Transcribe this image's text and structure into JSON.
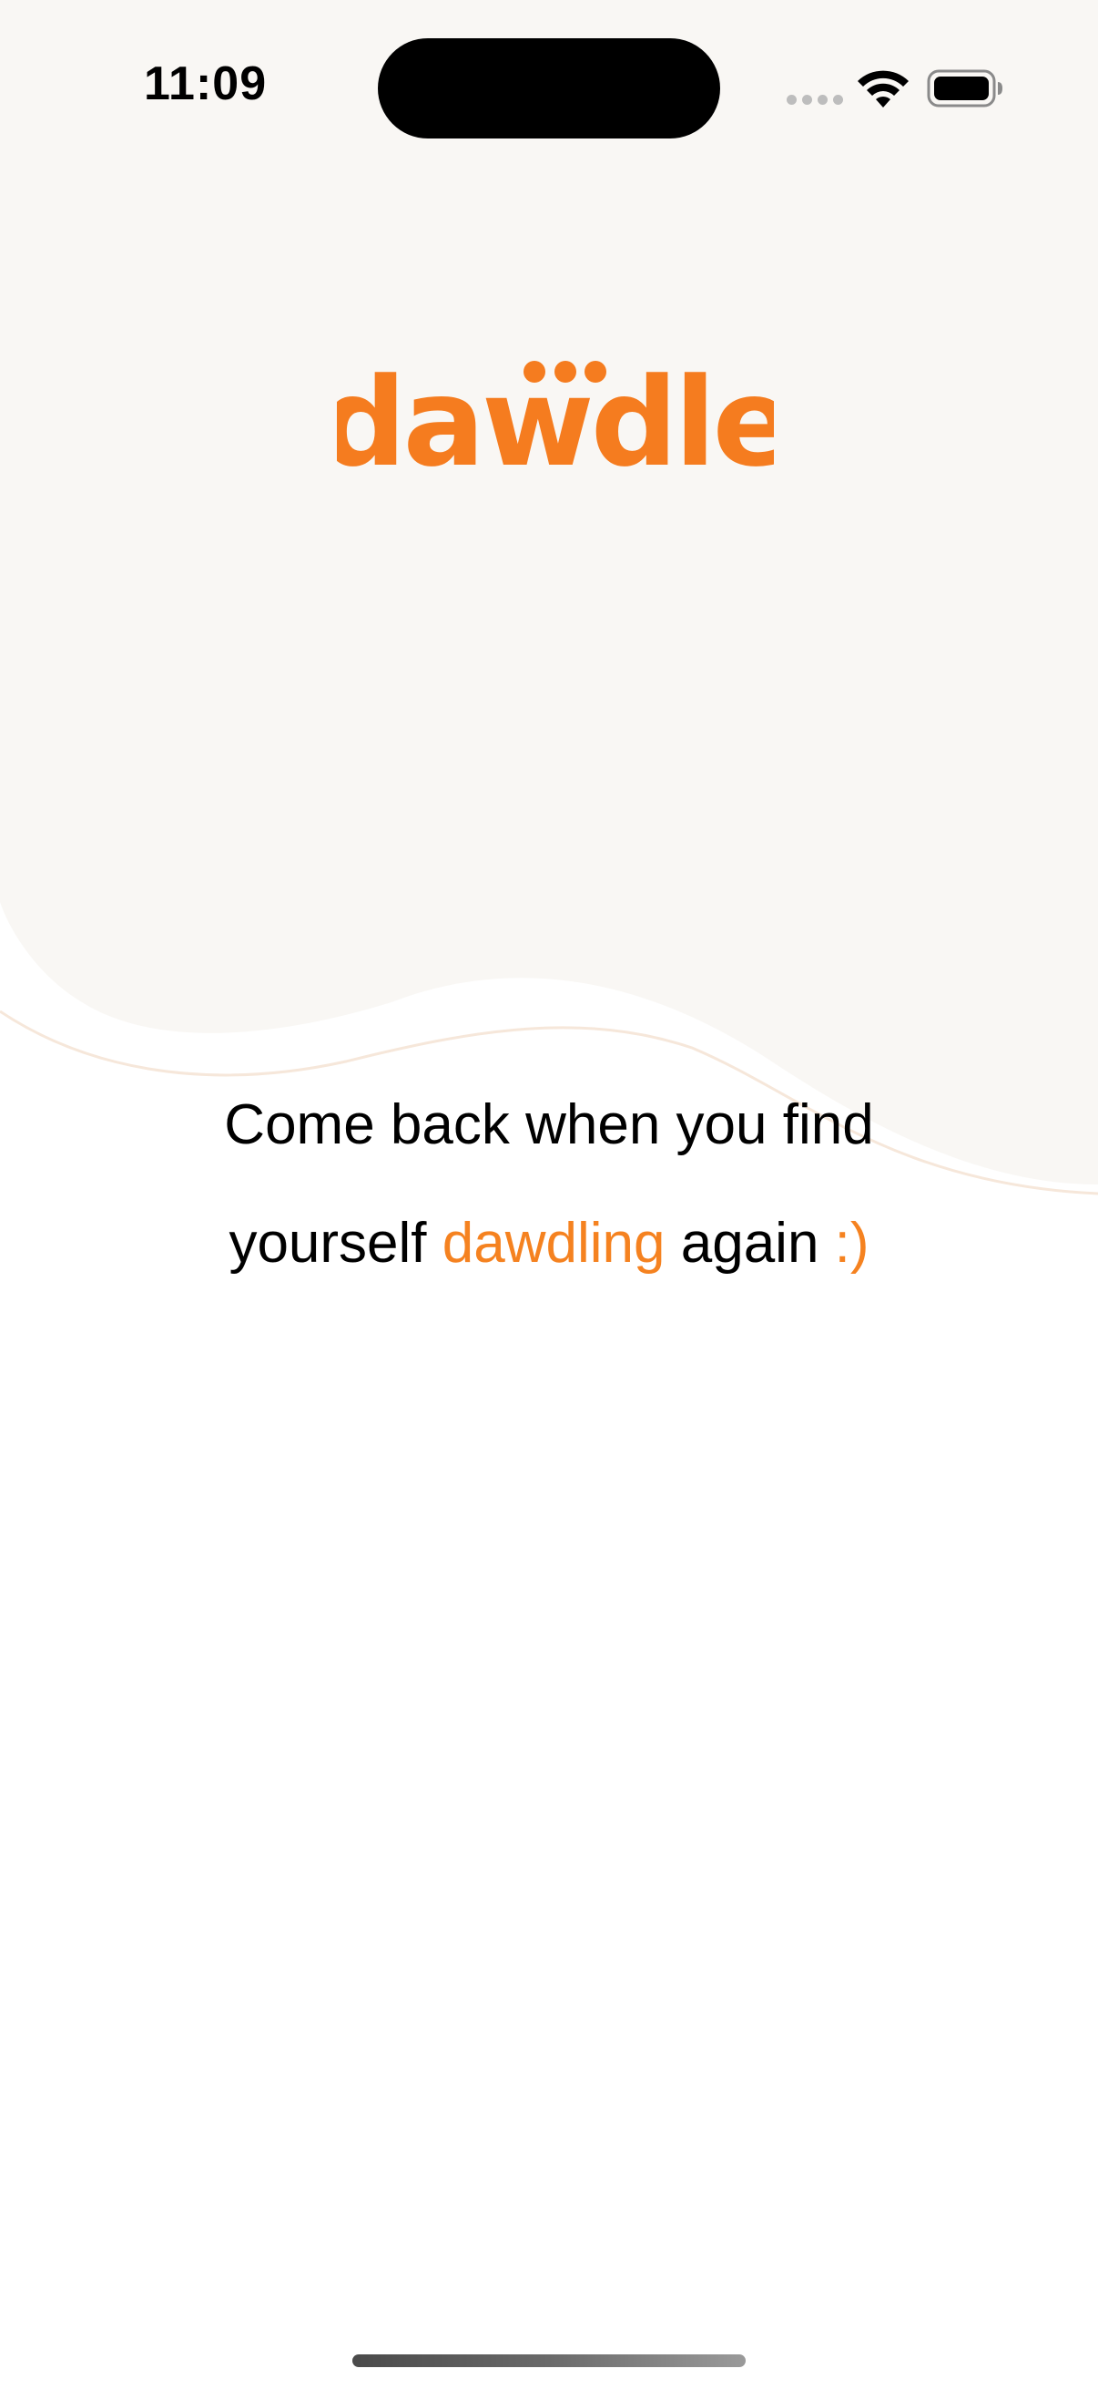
{
  "status_bar": {
    "time": "11:09"
  },
  "logo": {
    "text": "dawdle",
    "color": "#f57c1f"
  },
  "message": {
    "line1": "Come back when you find",
    "line2_prefix": "yourself",
    "line2_highlight": "dawdling",
    "line2_suffix": "again",
    "line2_emoticon": ":)"
  },
  "colors": {
    "accent": "#f58220",
    "background_top": "#f9f7f4",
    "background_bottom": "#ffffff"
  },
  "icons": [
    "signal-dots-icon",
    "wifi-icon",
    "battery-icon"
  ]
}
